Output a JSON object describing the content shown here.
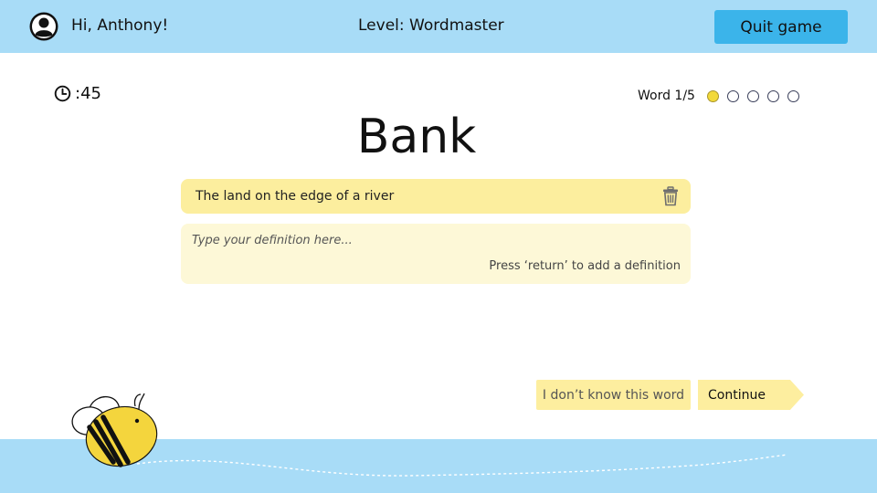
{
  "header": {
    "greeting": "Hi, Anthony!",
    "level": "Level: Wordmaster",
    "quit_label": "Quit game",
    "avatar_icon": "user-avatar-icon"
  },
  "timer": {
    "icon": "clock-icon",
    "value": ":45"
  },
  "progress": {
    "label": "Word 1/5",
    "current": 1,
    "total": 5
  },
  "word": "Bank",
  "definitions": [
    {
      "text": "The land on the edge of a river",
      "delete_icon": "trash-icon"
    }
  ],
  "input": {
    "value": "",
    "placeholder": "Type your definition here...",
    "hint": "Press ‘return’ to add a definition"
  },
  "actions": {
    "dont_know_label": "I don’t know this word",
    "continue_label": "Continue"
  },
  "colors": {
    "header_bg": "#a8dcf7",
    "quit_button": "#3bb4ea",
    "definition_bg": "#fcee9e",
    "input_bg": "#fdf8d7",
    "button_bg": "#fdee9f",
    "active_dot": "#f2d93a",
    "bee_yellow": "#f4d53d"
  },
  "mascot": {
    "icon": "bee-mascot-icon"
  }
}
